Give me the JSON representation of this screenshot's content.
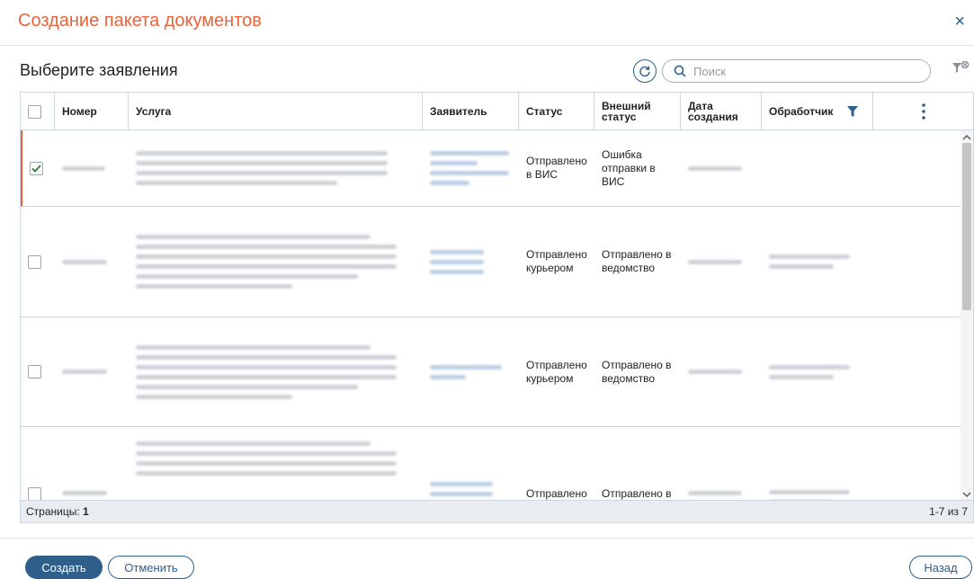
{
  "dialog": {
    "title": "Создание пакета документов",
    "close_icon": "×"
  },
  "section": {
    "title": "Выберите заявления"
  },
  "search": {
    "placeholder": "Поиск",
    "value": ""
  },
  "table": {
    "columns": [
      "Номер",
      "Услуга",
      "Заявитель",
      "Статус",
      "Внешний статус",
      "Дата создания",
      "Обработчик"
    ],
    "rows": [
      {
        "selected": true,
        "status": "Отправлено в ВИС",
        "external_status": "Ошибка отправки в ВИС"
      },
      {
        "selected": false,
        "status": "Отправлено курьером",
        "external_status": "Отправлено в ведомство"
      },
      {
        "selected": false,
        "status": "Отправлено курьером",
        "external_status": "Отправлено в ведомство"
      },
      {
        "selected": false,
        "status": "Отправлено курьером",
        "external_status": "Отправлено в ведомство"
      }
    ]
  },
  "footer": {
    "pages_label": "Страницы:",
    "pages_value": "1",
    "range": "1-7 из 7"
  },
  "buttons": {
    "create": "Создать",
    "cancel": "Отменить",
    "back": "Назад"
  },
  "colors": {
    "accent": "#e8633a",
    "primary": "#2d5f8a"
  }
}
